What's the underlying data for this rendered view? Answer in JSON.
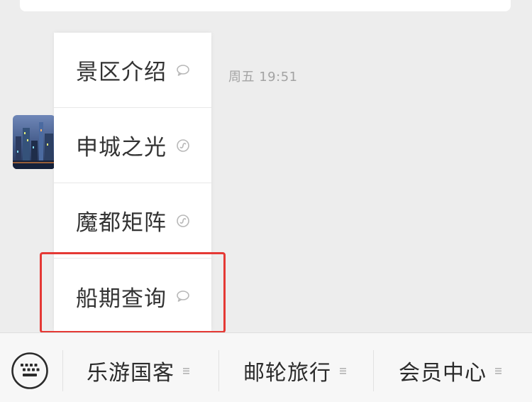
{
  "chat": {
    "timestamp": "周五 19:51"
  },
  "menu": {
    "items": [
      {
        "label": "景区介绍",
        "icon": "chat-bubble-icon"
      },
      {
        "label": "申城之光",
        "icon": "mini-program-icon"
      },
      {
        "label": "魔都矩阵",
        "icon": "mini-program-icon"
      },
      {
        "label": "船期查询",
        "icon": "chat-bubble-icon"
      }
    ]
  },
  "bottom_bar": {
    "keyboard_icon": "keyboard-icon",
    "items": [
      {
        "label": "乐游国客",
        "icon": "menu-lines-icon"
      },
      {
        "label": "邮轮旅行",
        "icon": "menu-lines-icon"
      },
      {
        "label": "会员中心",
        "icon": "menu-lines-icon"
      }
    ]
  },
  "colors": {
    "background": "#ededed",
    "highlight": "#e53935",
    "text": "#333333",
    "muted": "#a3a3a3"
  }
}
